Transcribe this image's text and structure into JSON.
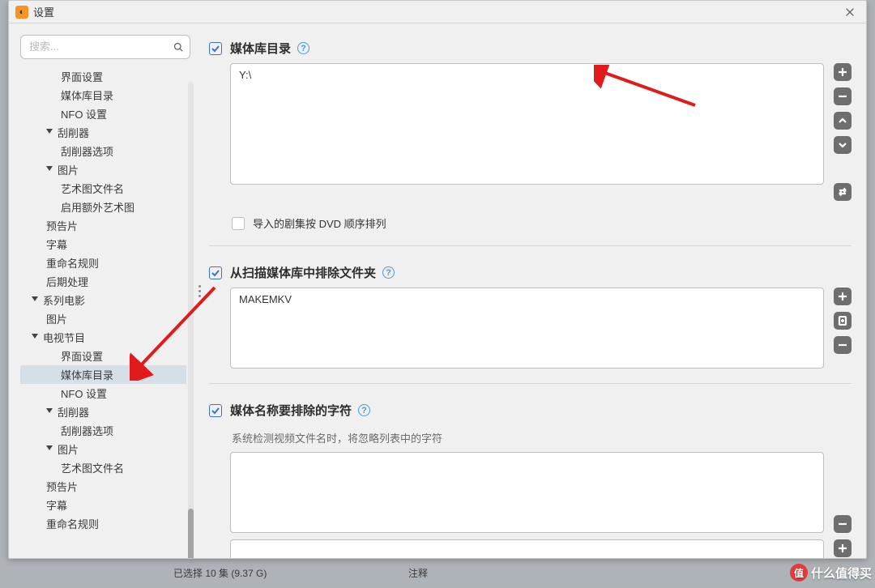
{
  "window": {
    "title": "设置"
  },
  "search": {
    "placeholder": "搜索..."
  },
  "sidebar": {
    "items": [
      {
        "label": "界面设置",
        "level": 2,
        "expandable": false,
        "selected": false
      },
      {
        "label": "媒体库目录",
        "level": 2,
        "expandable": false,
        "selected": false
      },
      {
        "label": "NFO 设置",
        "level": 2,
        "expandable": false,
        "selected": false
      },
      {
        "label": "刮削器",
        "level": 1,
        "expandable": true,
        "selected": false
      },
      {
        "label": "刮削器选项",
        "level": 2,
        "expandable": false,
        "selected": false
      },
      {
        "label": "图片",
        "level": 1,
        "expandable": true,
        "selected": false
      },
      {
        "label": "艺术图文件名",
        "level": 2,
        "expandable": false,
        "selected": false
      },
      {
        "label": "启用额外艺术图",
        "level": 2,
        "expandable": false,
        "selected": false
      },
      {
        "label": "预告片",
        "level": 1,
        "expandable": false,
        "selected": false
      },
      {
        "label": "字幕",
        "level": 1,
        "expandable": false,
        "selected": false
      },
      {
        "label": "重命名规则",
        "level": 1,
        "expandable": false,
        "selected": false
      },
      {
        "label": "后期处理",
        "level": 1,
        "expandable": false,
        "selected": false
      },
      {
        "label": "系列电影",
        "level": 0,
        "expandable": true,
        "selected": false
      },
      {
        "label": "图片",
        "level": 1,
        "expandable": false,
        "selected": false
      },
      {
        "label": "电视节目",
        "level": 0,
        "expandable": true,
        "selected": false
      },
      {
        "label": "界面设置",
        "level": 2,
        "expandable": false,
        "selected": false
      },
      {
        "label": "媒体库目录",
        "level": 2,
        "expandable": false,
        "selected": true
      },
      {
        "label": "NFO 设置",
        "level": 2,
        "expandable": false,
        "selected": false
      },
      {
        "label": "刮削器",
        "level": 1,
        "expandable": true,
        "selected": false
      },
      {
        "label": "刮削器选项",
        "level": 2,
        "expandable": false,
        "selected": false
      },
      {
        "label": "图片",
        "level": 1,
        "expandable": true,
        "selected": false
      },
      {
        "label": "艺术图文件名",
        "level": 2,
        "expandable": false,
        "selected": false
      },
      {
        "label": "预告片",
        "level": 1,
        "expandable": false,
        "selected": false
      },
      {
        "label": "字幕",
        "level": 1,
        "expandable": false,
        "selected": false
      },
      {
        "label": "重命名规则",
        "level": 1,
        "expandable": false,
        "selected": false
      }
    ]
  },
  "main": {
    "section1": {
      "title": "媒体库目录",
      "list_items": [
        "Y:\\"
      ],
      "checkbox_label": "导入的剧集按 DVD 顺序排列"
    },
    "section2": {
      "title": "从扫描媒体库中排除文件夹",
      "list_items": [
        "MAKEMKV"
      ]
    },
    "section3": {
      "title": "媒体名称要排除的字符",
      "subtext": "系统检测视频文件名时，将忽略列表中的字符",
      "list_items": []
    }
  },
  "status": {
    "left": "已选择 10 集 (9.37 G)",
    "right": "注释"
  },
  "watermark": {
    "brand_char": "值",
    "text": "什么值得买"
  },
  "colors": {
    "accent": "#3875c7",
    "icon_btn": "#6e6e6e",
    "arrow": "#e11b1b"
  }
}
